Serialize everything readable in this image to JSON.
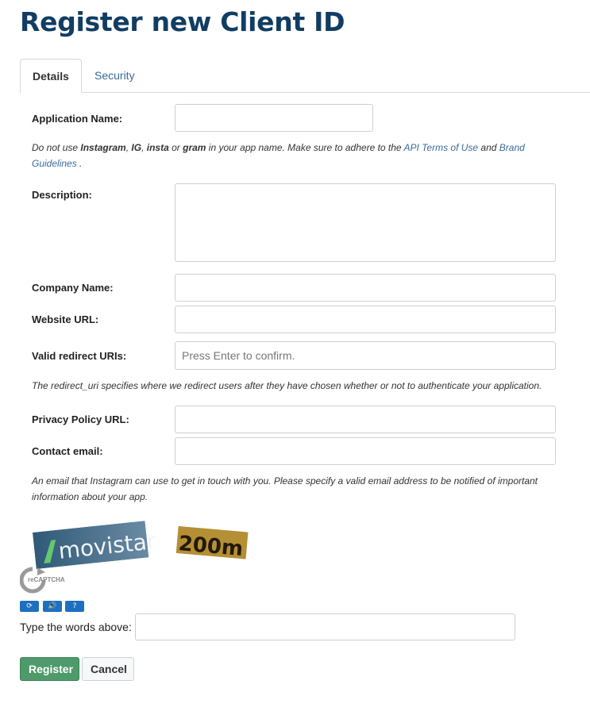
{
  "page": {
    "title": "Register new Client ID"
  },
  "tabs": [
    {
      "label": "Details",
      "active": true
    },
    {
      "label": "Security",
      "active": false
    }
  ],
  "form": {
    "app_name": {
      "label": "Application Name:",
      "value": ""
    },
    "app_name_help": {
      "t1": "Do not use ",
      "b1": "Instagram",
      "t2": ", ",
      "b2": "IG",
      "t3": ", ",
      "b3": "insta",
      "t4": " or ",
      "b4": "gram",
      "t5": " in your app name. Make sure to adhere to the ",
      "link1": "API Terms of Use",
      "t6": " and ",
      "link2": "Brand Guidelines",
      "t7": " ."
    },
    "description": {
      "label": "Description:",
      "value": ""
    },
    "company": {
      "label": "Company Name:",
      "value": ""
    },
    "website": {
      "label": "Website URL:",
      "value": ""
    },
    "redirect": {
      "label": "Valid redirect URIs:",
      "placeholder": "Press Enter to confirm.",
      "value": ""
    },
    "redirect_help": "The redirect_uri specifies where we redirect users after they have chosen whether or not to authenticate your application.",
    "privacy": {
      "label": "Privacy Policy URL:",
      "value": ""
    },
    "contact": {
      "label": "Contact email:",
      "value": ""
    },
    "contact_help": "An email that Instagram can use to get in touch with you. Please specify a valid email address to be notified of important information about your app."
  },
  "captcha": {
    "word1": "movistar",
    "word2": "200m",
    "brand": "reCAPTCHA",
    "type_label": "Type the words above:",
    "response": "",
    "icons": [
      "refresh-icon",
      "audio-icon",
      "help-icon"
    ]
  },
  "buttons": {
    "register": "Register",
    "cancel": "Cancel"
  },
  "colors": {
    "title": "#123d63",
    "link": "#3a6a9b",
    "register": "#4e9a6b"
  }
}
